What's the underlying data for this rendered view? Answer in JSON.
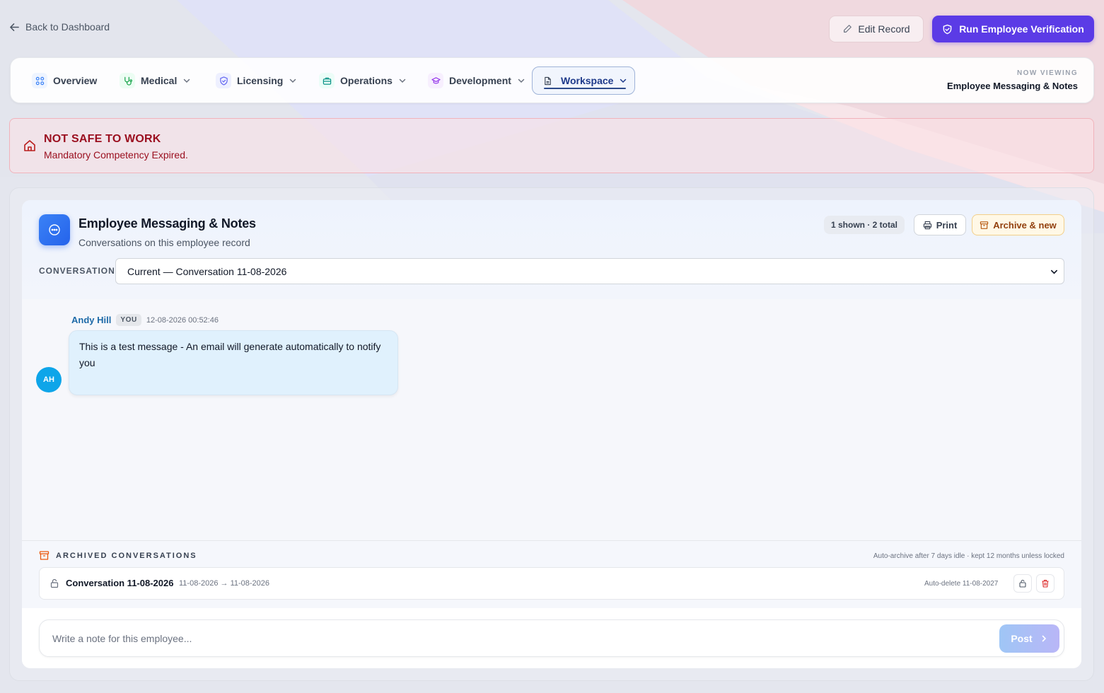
{
  "top": {
    "back_label": "Back to Dashboard",
    "edit_label": "Edit Record",
    "verify_label": "Run Employee Verification"
  },
  "tabs": [
    {
      "label": "Overview",
      "icon": "grid-icon",
      "color": "#3b82f6",
      "has_menu": false
    },
    {
      "label": "Medical",
      "icon": "stethoscope-icon",
      "color": "#16a34a",
      "has_menu": true
    },
    {
      "label": "Licensing",
      "icon": "shield-icon",
      "color": "#6366f1",
      "has_menu": true
    },
    {
      "label": "Operations",
      "icon": "briefcase-icon",
      "color": "#0d9488",
      "has_menu": true
    },
    {
      "label": "Development",
      "icon": "graduation-cap-icon",
      "color": "#9333ea",
      "has_menu": true
    },
    {
      "label": "Workspace",
      "icon": "document-icon",
      "color": "#1e3a8a",
      "has_menu": true,
      "active": true
    }
  ],
  "now_viewing": {
    "label": "NOW VIEWING",
    "value": "Employee Messaging & Notes"
  },
  "alert": {
    "title": "NOT SAFE TO WORK",
    "message": "Mandatory Competency Expired.",
    "color": "#9b1020"
  },
  "panel": {
    "title": "Employee Messaging & Notes",
    "subtitle": "Conversations on this employee record",
    "count": "1 shown · 2 total",
    "print_label": "Print",
    "archive_label": "Archive & new",
    "conversation_label": "CONVERSATION",
    "conversation_selected": "Current — Conversation 11-08-2026"
  },
  "messages": [
    {
      "author": "Andy Hill",
      "badge": "YOU",
      "time": "12-08-2026 00:52:46",
      "text": "This is a test message - An email will generate automatically to notify you",
      "initials": "AH"
    }
  ],
  "archived": {
    "heading": "ARCHIVED CONVERSATIONS",
    "note": "Auto-archive after 7 days idle · kept 12 months unless locked",
    "items": [
      {
        "title": "Conversation 11-08-2026",
        "range": "11-08-2026 → 11-08-2026",
        "delete_note": "Auto-delete 11-08-2027"
      }
    ]
  },
  "composer": {
    "placeholder": "Write a note for this employee...",
    "post_label": "Post"
  },
  "colors": {
    "accent": "#5b3be6",
    "danger": "#b91c1c",
    "bubble": "#e0f1fd",
    "avatar": "#0ea5e9"
  }
}
